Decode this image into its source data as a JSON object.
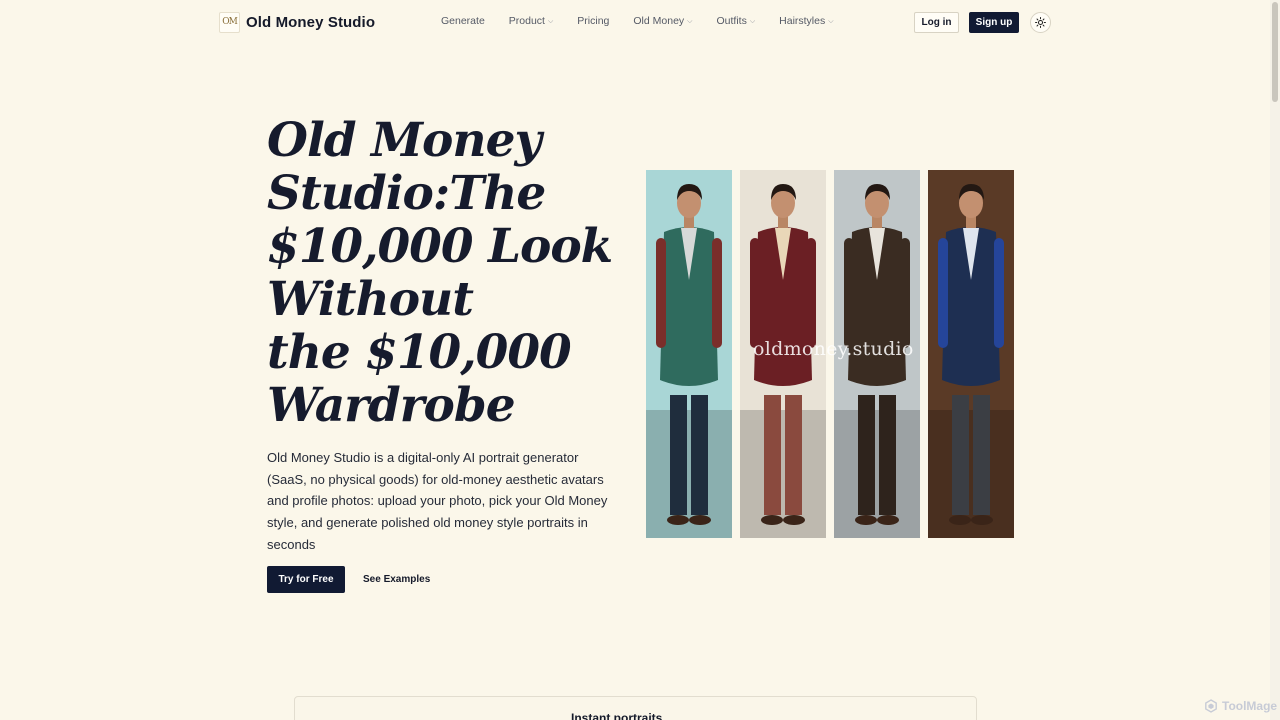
{
  "header": {
    "logo_text": "OM",
    "brand_name": "Old Money Studio",
    "nav": [
      {
        "label": "Generate",
        "dropdown": false
      },
      {
        "label": "Product",
        "dropdown": true
      },
      {
        "label": "Pricing",
        "dropdown": false
      },
      {
        "label": "Old Money",
        "dropdown": true
      },
      {
        "label": "Outfits",
        "dropdown": true
      },
      {
        "label": "Hairstyles",
        "dropdown": true
      }
    ],
    "login_label": "Log in",
    "signup_label": "Sign up",
    "theme_icon": "sun-icon"
  },
  "hero": {
    "title_lines": [
      "Old Money",
      "Studio:The",
      "$10,000 Look",
      "Without",
      "the $10,000",
      "Wardrobe"
    ],
    "description": "Old Money Studio is a digital-only AI portrait generator (SaaS, no physical goods) for old-money aesthetic avatars and profile photos: upload your photo, pick your Old Money style, and generate polished old money style portraits in seconds",
    "cta_primary": "Try for Free",
    "cta_secondary": "See Examples"
  },
  "gallery": {
    "watermark": "oldmoney.studio",
    "photos": [
      {
        "name": "green-shirt-portrait",
        "jacket": "#2f6b5e",
        "accent": "#7a2e2a",
        "shirt": "#d7d9d8",
        "pants": "#1f2d3d",
        "bg": "#a9d6d6"
      },
      {
        "name": "burgundy-suit-portrait",
        "jacket": "#6b1f24",
        "accent": "#6b1f24",
        "shirt": "#e9d7b8",
        "pants": "#8a4a3e",
        "bg": "#e8e2d6"
      },
      {
        "name": "brown-three-piece-portrait",
        "jacket": "#3a2c22",
        "accent": "#3a2c22",
        "shirt": "#e8e4dc",
        "pants": "#2e231c",
        "bg": "#bfc6c8"
      },
      {
        "name": "navy-overcoat-portrait",
        "jacket": "#1e2f52",
        "accent": "#25459a",
        "shirt": "#dfe5ee",
        "pants": "#3b3e44",
        "bg": "#5a3a26"
      }
    ]
  },
  "bottom_card": {
    "title": "Instant portraits"
  },
  "badge": {
    "text": "ToolMage"
  }
}
